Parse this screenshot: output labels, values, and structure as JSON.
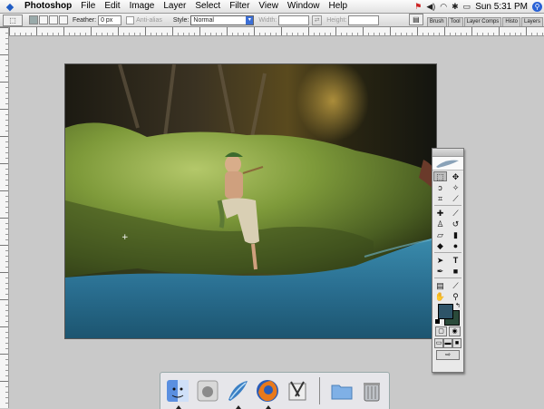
{
  "menubar": {
    "app_name": "Photoshop",
    "items": [
      "File",
      "Edit",
      "Image",
      "Layer",
      "Select",
      "Filter",
      "View",
      "Window",
      "Help"
    ],
    "clock": "Sun 5:31 PM",
    "status_icons": [
      "flag-icon",
      "volume-icon",
      "wifi-icon",
      "bluetooth-icon",
      "battery-icon",
      "spotlight-icon"
    ]
  },
  "options_bar": {
    "feather_label": "Feather:",
    "feather_value": "0 px",
    "antialias_label": "Anti-alias",
    "style_label": "Style:",
    "style_value": "Normal",
    "width_label": "Width:",
    "height_label": "Height:",
    "palette_tabs": [
      "Brush",
      "Tool",
      "Layer Comps",
      "Histo",
      "Layers"
    ]
  },
  "toolbox": {
    "foreground_color": "#2e5468",
    "background_color": "#2a4a3a",
    "selected_tool": "rectangular-marquee"
  },
  "document": {
    "description": "forest stream scene"
  },
  "dock": {
    "items": [
      "Finder",
      "Apple",
      "Photoshop",
      "Firefox",
      "Script Editor",
      "Documents",
      "Trash"
    ]
  }
}
